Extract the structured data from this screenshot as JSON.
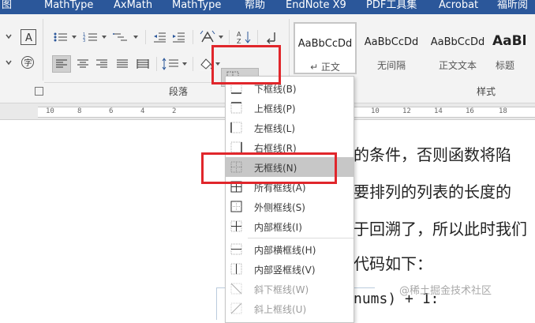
{
  "tabs": [
    "图",
    "MathType",
    "AxMath",
    "MathType",
    "帮助",
    "EndNote X9",
    "PDF工具集",
    "Acrobat",
    "福昕阅"
  ],
  "ribbon": {
    "paragraph_group_label": "段落",
    "styles_group_label": "样式",
    "styles": [
      {
        "preview": "AaBbCcDd",
        "name": "↵ 正文",
        "selected": true
      },
      {
        "preview": "AaBbCcDd",
        "name": "无间隔",
        "selected": false
      },
      {
        "preview": "AaBbCcDd",
        "name": "正文文本",
        "selected": false
      },
      {
        "preview": "AaBl",
        "name": "标题",
        "selected": false
      }
    ]
  },
  "ruler": {
    "numbers": [
      "10",
      "8",
      "6",
      "4",
      "2",
      "10",
      "12",
      "14",
      "16",
      "18"
    ]
  },
  "document": {
    "lines": [
      "的条件，否则函数将陷",
      "要排列的列表的长度的",
      "于回溯了，所以此时我们",
      "代码如下：",
      "nums) + 1:"
    ],
    "watermark": "@稀土掘金技术社区"
  },
  "border_menu": {
    "items": [
      {
        "label": "下框线(B)",
        "icon": "bottom-border-icon",
        "state": "normal"
      },
      {
        "label": "上框线(P)",
        "icon": "top-border-icon",
        "state": "normal"
      },
      {
        "label": "左框线(L)",
        "icon": "left-border-icon",
        "state": "normal"
      },
      {
        "label": "右框线(R)",
        "icon": "right-border-icon",
        "state": "normal"
      },
      {
        "label": "无框线(N)",
        "icon": "no-border-icon",
        "state": "hovered"
      },
      {
        "label": "所有框线(A)",
        "icon": "all-borders-icon",
        "state": "normal"
      },
      {
        "label": "外侧框线(S)",
        "icon": "outside-borders-icon",
        "state": "normal"
      },
      {
        "label": "内部框线(I)",
        "icon": "inside-borders-icon",
        "state": "normal"
      },
      {
        "label": "内部横框线(H)",
        "icon": "inside-horizontal-border-icon",
        "state": "normal"
      },
      {
        "label": "内部竖框线(V)",
        "icon": "inside-vertical-border-icon",
        "state": "normal"
      },
      {
        "label": "斜下框线(W)",
        "icon": "diagonal-down-border-icon",
        "state": "disabled"
      },
      {
        "label": "斜上框线(U)",
        "icon": "diagonal-up-border-icon",
        "state": "disabled"
      }
    ]
  },
  "colors": {
    "tab_bar": "#2b579a",
    "highlight": "#e0262b",
    "hover": "#c7c7c7"
  }
}
